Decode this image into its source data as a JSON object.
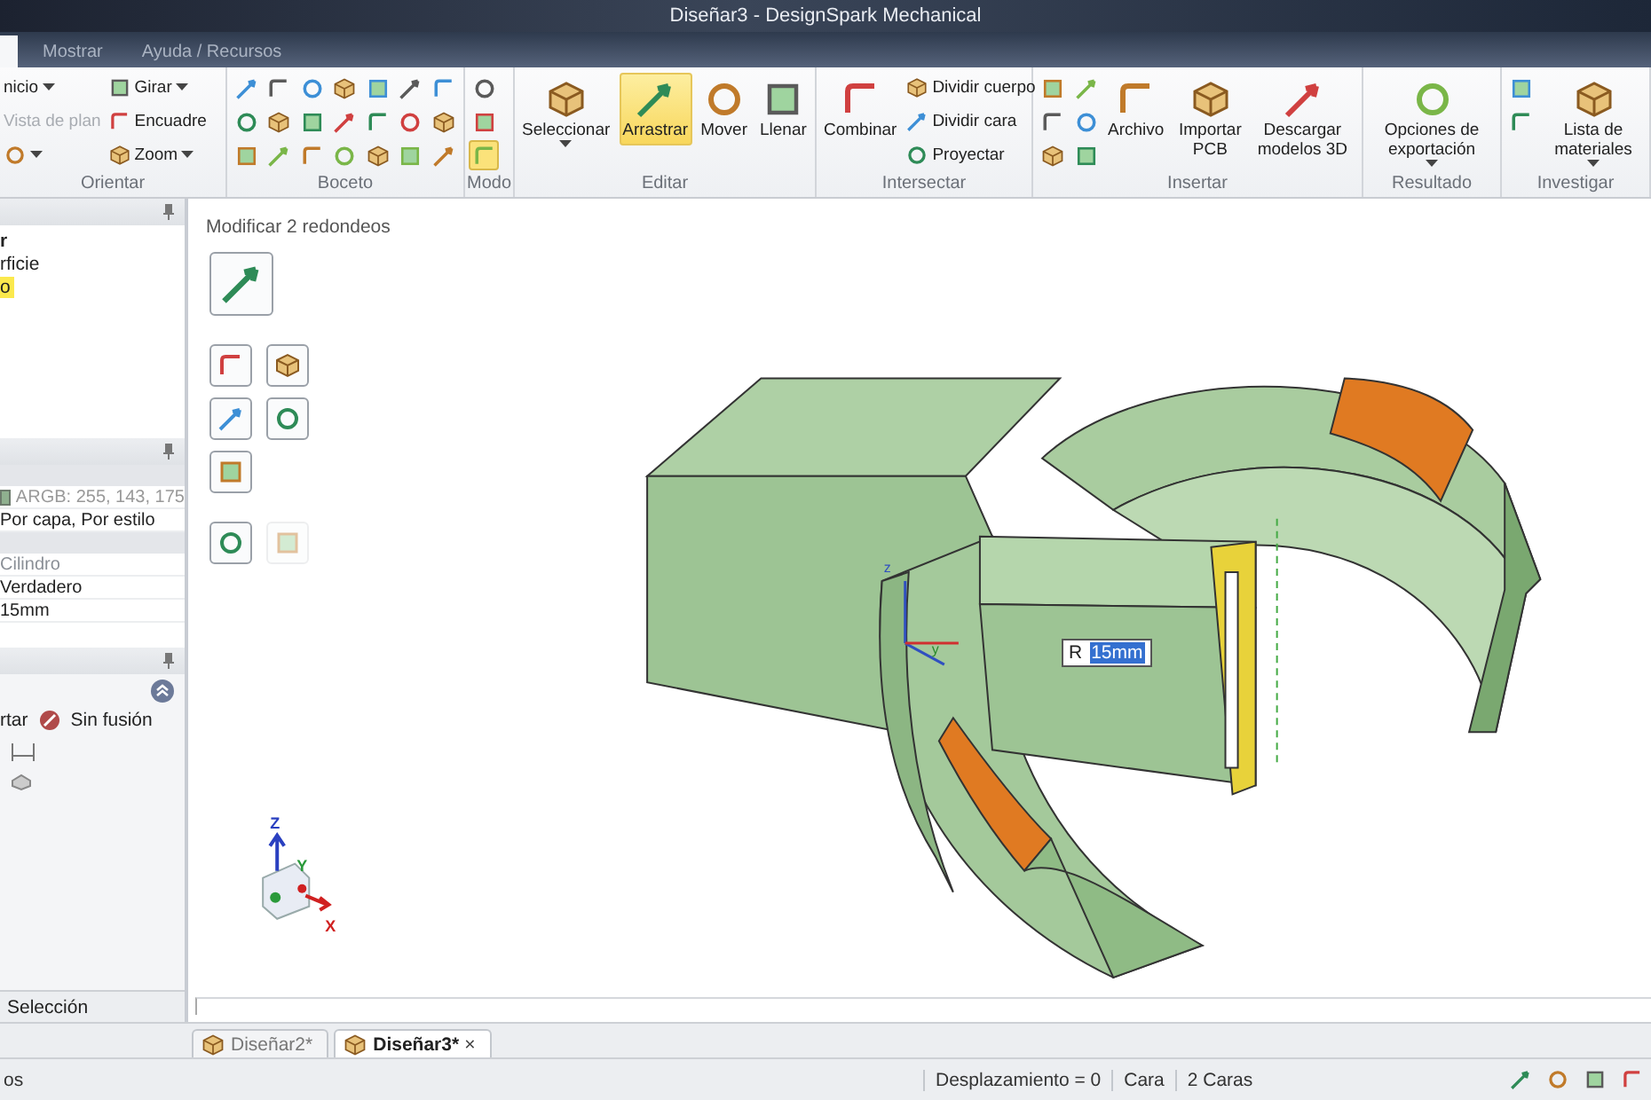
{
  "window": {
    "title": "Diseñar3 - DesignSpark Mechanical"
  },
  "menu_tabs": [
    {
      "label": "Mostrar",
      "selected": false
    },
    {
      "label": "Ayuda / Recursos",
      "selected": false
    }
  ],
  "ribbon": {
    "groups": [
      {
        "title": "Orientar",
        "columns": [
          [
            {
              "kind": "small",
              "label": "nicio",
              "dropdown": true,
              "disabled": false
            },
            {
              "kind": "small",
              "label": "Vista de plan",
              "dropdown": false,
              "disabled": true
            },
            {
              "kind": "small",
              "dropdown": true,
              "disabled": false
            }
          ],
          [
            {
              "kind": "small",
              "label": "Girar",
              "dropdown": true,
              "disabled": false
            },
            {
              "kind": "small",
              "label": "Encuadre",
              "dropdown": false,
              "disabled": false
            },
            {
              "kind": "small",
              "label": "Zoom",
              "dropdown": true,
              "disabled": false
            }
          ]
        ]
      },
      {
        "title": "Boceto",
        "columns": [
          [
            {
              "kind": "icon",
              "selected": false
            },
            {
              "kind": "icon",
              "selected": false
            },
            {
              "kind": "icon",
              "selected": false
            }
          ],
          [
            {
              "kind": "icon",
              "selected": false
            },
            {
              "kind": "icon",
              "selected": false
            },
            {
              "kind": "icon",
              "selected": false
            }
          ],
          [
            {
              "kind": "icon",
              "selected": false
            },
            {
              "kind": "icon",
              "selected": false
            },
            {
              "kind": "icon",
              "selected": false
            }
          ],
          [
            {
              "kind": "icon",
              "selected": false
            },
            {
              "kind": "icon",
              "selected": false
            },
            {
              "kind": "icon",
              "selected": false
            }
          ],
          [
            {
              "kind": "icon",
              "selected": false
            },
            {
              "kind": "icon",
              "selected": false
            },
            {
              "kind": "icon",
              "selected": false
            }
          ],
          [
            {
              "kind": "icon",
              "selected": false
            },
            {
              "kind": "icon",
              "selected": false
            },
            {
              "kind": "icon",
              "selected": false
            }
          ],
          [
            {
              "kind": "icon",
              "selected": false
            },
            {
              "kind": "icon",
              "selected": false
            },
            {
              "kind": "icon",
              "selected": false
            }
          ]
        ]
      },
      {
        "title": "Modo",
        "columns": [
          [
            {
              "kind": "icon",
              "selected": false
            },
            {
              "kind": "icon",
              "selected": false
            },
            {
              "kind": "icon",
              "selected": true
            }
          ]
        ]
      },
      {
        "title": "Editar",
        "columns": [
          [
            {
              "kind": "large",
              "label": "Seleccionar",
              "dropdown": true,
              "selected": false
            }
          ],
          [
            {
              "kind": "large",
              "label": "Arrastrar",
              "dropdown": false,
              "selected": true
            }
          ],
          [
            {
              "kind": "large",
              "label": "Mover",
              "dropdown": false,
              "selected": false
            }
          ],
          [
            {
              "kind": "large",
              "label": "Llenar",
              "dropdown": false,
              "selected": false
            }
          ]
        ]
      },
      {
        "title": "Intersectar",
        "columns": [
          [
            {
              "kind": "large",
              "label": "Combinar",
              "dropdown": false,
              "selected": false
            }
          ],
          [
            {
              "kind": "small",
              "label": "Dividir cuerpo",
              "dropdown": false,
              "disabled": false
            },
            {
              "kind": "small",
              "label": "Dividir cara",
              "dropdown": false,
              "disabled": false
            },
            {
              "kind": "small",
              "label": "Proyectar",
              "dropdown": false,
              "disabled": false
            }
          ]
        ]
      },
      {
        "title": "Insertar",
        "columns": [
          [
            {
              "kind": "icon",
              "selected": false
            },
            {
              "kind": "icon",
              "selected": false
            },
            {
              "kind": "icon",
              "selected": false
            }
          ],
          [
            {
              "kind": "icon",
              "selected": false
            },
            {
              "kind": "icon",
              "selected": false
            },
            {
              "kind": "icon",
              "selected": false
            }
          ],
          [
            {
              "kind": "large",
              "label": "Archivo",
              "dropdown": false,
              "selected": false
            }
          ],
          [
            {
              "kind": "large",
              "label": "Importar PCB",
              "dropdown": false,
              "selected": false
            }
          ],
          [
            {
              "kind": "large",
              "label": "Descargar modelos 3D",
              "dropdown": false,
              "selected": false
            }
          ]
        ]
      },
      {
        "title": "Resultado",
        "columns": [
          [
            {
              "kind": "large",
              "label": "Opciones de exportación",
              "dropdown": true,
              "selected": false
            }
          ]
        ]
      },
      {
        "title": "Investigar",
        "columns": [
          [
            {
              "kind": "icon",
              "selected": false
            },
            {
              "kind": "icon",
              "selected": false
            }
          ],
          [
            {
              "kind": "large",
              "label": "Lista de materiales",
              "dropdown": true,
              "selected": false
            }
          ]
        ]
      }
    ]
  },
  "structure_panel": {
    "lines": [
      {
        "text": "r",
        "bold": true,
        "selected": false
      },
      {
        "text": "rficie",
        "bold": false,
        "selected": false
      },
      {
        "text": "o",
        "bold": false,
        "selected": true
      }
    ]
  },
  "properties_panel": {
    "rows": [
      {
        "kind": "color",
        "value": "ARGB: 255, 143, 175",
        "color": "#8fb08f"
      },
      {
        "kind": "text",
        "value": "Por capa, Por estilo",
        "disabled": false
      },
      {
        "kind": "section"
      },
      {
        "kind": "text",
        "value": "Cilindro",
        "disabled": true
      },
      {
        "kind": "text",
        "value": "Verdadero",
        "disabled": false
      },
      {
        "kind": "text",
        "value": "15mm",
        "disabled": false
      }
    ]
  },
  "options_panel": {
    "items": [
      {
        "label": "rtar"
      },
      {
        "label": "Sin fusión"
      }
    ]
  },
  "panel_tabs": [
    {
      "label": "Selección",
      "selected": true
    }
  ],
  "viewport": {
    "title": "Modificar 2 redondeos",
    "tool_groups": [
      [
        {
          "disabled": false
        }
      ],
      [
        {
          "disabled": false
        },
        {
          "disabled": false
        },
        {
          "disabled": false
        },
        {
          "disabled": false
        },
        {
          "disabled": false
        }
      ],
      [
        {
          "disabled": false
        },
        {
          "disabled": true
        }
      ]
    ],
    "dimension": {
      "prefix": "R",
      "value": "15mm"
    },
    "model_axes": [
      "z",
      "y"
    ],
    "triad_axes": [
      "Z",
      "Y",
      "X"
    ]
  },
  "document_tabs": [
    {
      "label": "Diseñar2*",
      "selected": false
    },
    {
      "label": "Diseñar3*",
      "selected": true,
      "close": "×"
    }
  ],
  "status_bar": {
    "left": "os",
    "fields": [
      "Desplazamiento = 0",
      "Cara",
      "2 Caras"
    ]
  }
}
